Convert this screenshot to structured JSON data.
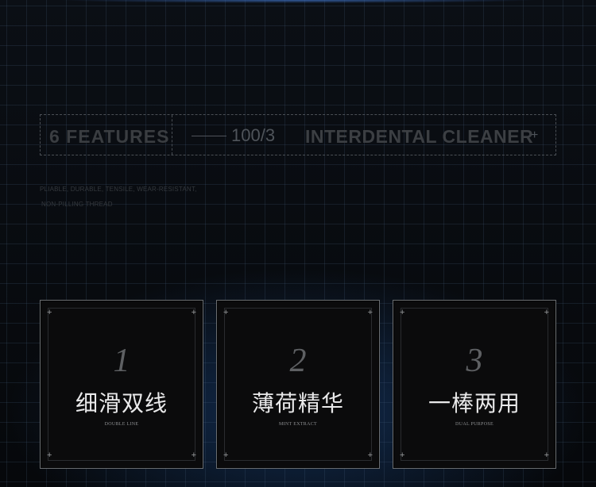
{
  "header": {
    "features_label": "6 FEATURES",
    "count_label": "100/3",
    "product_label": "INTERDENTAL CLEANER",
    "plus_label": "+"
  },
  "description": {
    "line1": "PLIABLE, DURABLE, TENSILE, WEAR-RESISTANT,",
    "line2": "NON-PILLING THREAD"
  },
  "cards": [
    {
      "number": "1",
      "title": "细滑双线",
      "subtitle": "DOUBLE LINE"
    },
    {
      "number": "2",
      "title": "薄荷精华",
      "subtitle": "MINT EXTRACT"
    },
    {
      "number": "3",
      "title": "一棒两用",
      "subtitle": "DUAL PURPOSE"
    }
  ],
  "corner_glyph": "+"
}
